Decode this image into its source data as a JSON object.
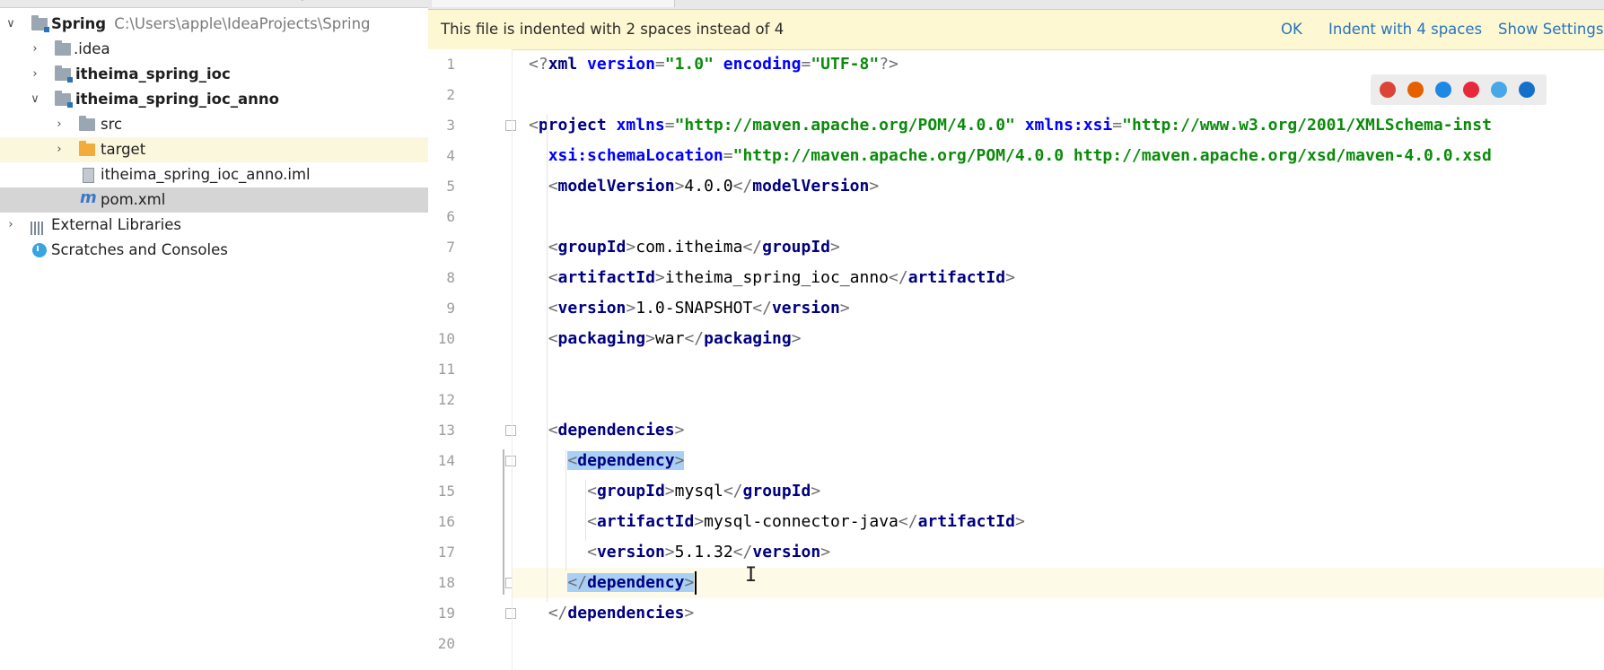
{
  "project_tree": {
    "root": {
      "name": "Spring",
      "path": "C:\\Users\\apple\\IdeaProjects\\Spring"
    },
    "items": [
      {
        "label": ".idea"
      },
      {
        "label": "itheima_spring_ioc"
      },
      {
        "label": "itheima_spring_ioc_anno"
      },
      {
        "label": "src"
      },
      {
        "label": "target"
      },
      {
        "label": "itheima_spring_ioc_anno.iml"
      },
      {
        "label": "pom.xml"
      },
      {
        "label": "External Libraries"
      },
      {
        "label": "Scratches and Consoles"
      }
    ]
  },
  "notification": {
    "message": "This file is indented with 2 spaces instead of 4",
    "actions": [
      "OK",
      "Indent with 4 spaces",
      "Show Settings"
    ]
  },
  "editor": {
    "line_numbers": [
      "1",
      "2",
      "3",
      "4",
      "5",
      "6",
      "7",
      "8",
      "9",
      "10",
      "11",
      "12",
      "13",
      "14",
      "15",
      "16",
      "17",
      "18",
      "19",
      "20"
    ],
    "current_line": 18,
    "lines": [
      {
        "n": 1,
        "indent": 0,
        "tokens": [
          [
            "pun",
            "<?"
          ],
          [
            "tag",
            "xml "
          ],
          [
            "attr",
            "version"
          ],
          [
            "pun",
            "="
          ],
          [
            "val",
            "\"1.0\" "
          ],
          [
            "attr",
            "encoding"
          ],
          [
            "pun",
            "="
          ],
          [
            "val",
            "\"UTF-8\""
          ],
          [
            "pun",
            "?>"
          ]
        ]
      },
      {
        "n": 2,
        "indent": 0,
        "tokens": []
      },
      {
        "n": 3,
        "indent": 0,
        "tokens": [
          [
            "pun",
            "<"
          ],
          [
            "tag",
            "project "
          ],
          [
            "attr",
            "xmlns"
          ],
          [
            "pun",
            "="
          ],
          [
            "val",
            "\"http://maven.apache.org/POM/4.0.0\" "
          ],
          [
            "attr",
            "xmlns:xsi"
          ],
          [
            "pun",
            "="
          ],
          [
            "val",
            "\"http://www.w3.org/2001/XMLSchema-inst"
          ]
        ]
      },
      {
        "n": 4,
        "indent": 2,
        "tokens": [
          [
            "attr",
            "xsi:schemaLocation"
          ],
          [
            "pun",
            "="
          ],
          [
            "val",
            "\"http://maven.apache.org/POM/4.0.0 http://maven.apache.org/xsd/maven-4.0.0.xsd"
          ]
        ]
      },
      {
        "n": 5,
        "indent": 2,
        "tokens": [
          [
            "pun",
            "<"
          ],
          [
            "tag",
            "modelVersion"
          ],
          [
            "pun",
            ">"
          ],
          [
            "txt",
            "4.0.0"
          ],
          [
            "pun",
            "</"
          ],
          [
            "tag",
            "modelVersion"
          ],
          [
            "pun",
            ">"
          ]
        ]
      },
      {
        "n": 6,
        "indent": 0,
        "tokens": []
      },
      {
        "n": 7,
        "indent": 2,
        "tokens": [
          [
            "pun",
            "<"
          ],
          [
            "tag",
            "groupId"
          ],
          [
            "pun",
            ">"
          ],
          [
            "txt",
            "com.itheima"
          ],
          [
            "pun",
            "</"
          ],
          [
            "tag",
            "groupId"
          ],
          [
            "pun",
            ">"
          ]
        ]
      },
      {
        "n": 8,
        "indent": 2,
        "tokens": [
          [
            "pun",
            "<"
          ],
          [
            "tag",
            "artifactId"
          ],
          [
            "pun",
            ">"
          ],
          [
            "txt",
            "itheima_spring_ioc_anno"
          ],
          [
            "pun",
            "</"
          ],
          [
            "tag",
            "artifactId"
          ],
          [
            "pun",
            ">"
          ]
        ]
      },
      {
        "n": 9,
        "indent": 2,
        "tokens": [
          [
            "pun",
            "<"
          ],
          [
            "tag",
            "version"
          ],
          [
            "pun",
            ">"
          ],
          [
            "txt",
            "1.0-SNAPSHOT"
          ],
          [
            "pun",
            "</"
          ],
          [
            "tag",
            "version"
          ],
          [
            "pun",
            ">"
          ]
        ]
      },
      {
        "n": 10,
        "indent": 2,
        "tokens": [
          [
            "pun",
            "<"
          ],
          [
            "tag",
            "packaging"
          ],
          [
            "pun",
            ">"
          ],
          [
            "txt",
            "war"
          ],
          [
            "pun",
            "</"
          ],
          [
            "tag",
            "packaging"
          ],
          [
            "pun",
            ">"
          ]
        ]
      },
      {
        "n": 11,
        "indent": 0,
        "tokens": []
      },
      {
        "n": 12,
        "indent": 0,
        "tokens": []
      },
      {
        "n": 13,
        "indent": 2,
        "tokens": [
          [
            "pun",
            "<"
          ],
          [
            "tag",
            "dependencies"
          ],
          [
            "pun",
            ">"
          ]
        ]
      },
      {
        "n": 14,
        "indent": 4,
        "tokens": [
          [
            "pun",
            "<",
            1
          ],
          [
            "tag",
            "dependency",
            1
          ],
          [
            "pun",
            ">",
            1
          ]
        ]
      },
      {
        "n": 15,
        "indent": 6,
        "tokens": [
          [
            "pun",
            "<"
          ],
          [
            "tag",
            "groupId"
          ],
          [
            "pun",
            ">"
          ],
          [
            "txt",
            "mysql"
          ],
          [
            "pun",
            "</"
          ],
          [
            "tag",
            "groupId"
          ],
          [
            "pun",
            ">"
          ]
        ]
      },
      {
        "n": 16,
        "indent": 6,
        "tokens": [
          [
            "pun",
            "<"
          ],
          [
            "tag",
            "artifactId"
          ],
          [
            "pun",
            ">"
          ],
          [
            "txt",
            "mysql-connector-java"
          ],
          [
            "pun",
            "</"
          ],
          [
            "tag",
            "artifactId"
          ],
          [
            "pun",
            ">"
          ]
        ]
      },
      {
        "n": 17,
        "indent": 6,
        "tokens": [
          [
            "pun",
            "<"
          ],
          [
            "tag",
            "version"
          ],
          [
            "pun",
            ">"
          ],
          [
            "txt",
            "5.1.32"
          ],
          [
            "pun",
            "</"
          ],
          [
            "tag",
            "version"
          ],
          [
            "pun",
            ">"
          ]
        ]
      },
      {
        "n": 18,
        "indent": 4,
        "tokens": [
          [
            "pun",
            "</",
            1
          ],
          [
            "tag",
            "dependency",
            1
          ],
          [
            "pun",
            ">",
            1
          ]
        ]
      },
      {
        "n": 19,
        "indent": 2,
        "tokens": [
          [
            "pun",
            "</"
          ],
          [
            "tag",
            "dependencies"
          ],
          [
            "pun",
            ">"
          ]
        ]
      },
      {
        "n": 20,
        "indent": 0,
        "tokens": []
      }
    ]
  },
  "browser_icons": [
    "chrome-icon",
    "firefox-icon",
    "safari-icon",
    "opera-icon",
    "ie-icon",
    "edge-icon"
  ],
  "colors": {
    "tag": "#000080",
    "attr": "#0000ff",
    "value": "#0b8b0b",
    "selection": "#a9cff5",
    "notification_bg": "#fdf8d1",
    "link": "#2675bf"
  }
}
